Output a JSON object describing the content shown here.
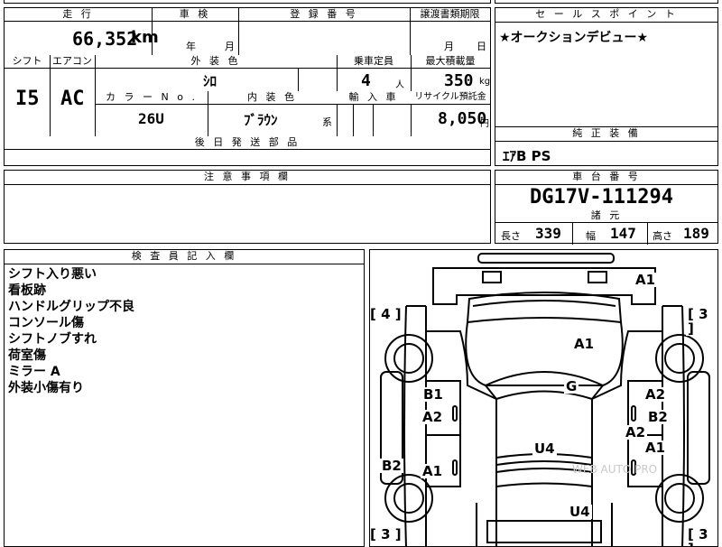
{
  "header_labels": {
    "mileage": "走 行",
    "inspection": "車 検",
    "registration_no": "登 録 番 号",
    "transfer_doc_date": "譲渡書類期限",
    "sales_point": "セ ー ル ス ポ イ ン ト",
    "shift": "シフト",
    "aircon": "エアコン",
    "exterior_color": "外 装 色",
    "capacity": "乗車定員",
    "max_load": "最大積載量",
    "color_no": "カ ラ ー N o .",
    "interior_color": "内 装 色",
    "imported": "輸 入 車",
    "recycle_fee": "リサイクル預託金",
    "later_parts": "後 日 発 送 部 品",
    "standard_equipment": "純 正 装 備",
    "caution": "注 意 事 項 欄",
    "chassis_no": "車 台 番 号",
    "specs": "諸 元",
    "inspector_notes": "検 査 員 記 入 欄"
  },
  "values": {
    "mileage": "66,352",
    "mileage_unit": "km",
    "year_unit": "年",
    "month_unit": "月",
    "doc_month_unit": "月",
    "doc_day_unit": "日",
    "sales_point": "★オークションデビュー★",
    "shift": "I5",
    "aircon": "AC",
    "exterior_color": "ｼﾛ",
    "capacity": "4",
    "capacity_unit": "人",
    "max_load": "350",
    "max_load_unit": "kg",
    "color_no": "26U",
    "interior_color": "ﾌﾞﾗｳﾝ",
    "interior_suffix": "系",
    "recycle_fee": "8,050",
    "recycle_unit": "円",
    "standard_equipment": "ｴｱB PS",
    "chassis_no": "DG17V-111294",
    "length_label": "長さ",
    "length": "339",
    "width_label": "幅",
    "width": "147",
    "height_label": "高さ",
    "height": "189"
  },
  "inspector_notes": [
    "シフト入り悪い",
    "看板跡",
    "ハンドルグリップ不良",
    "コンソール傷",
    "シフトノブすれ",
    "荷室傷",
    "ミラー A",
    "外装小傷有り"
  ],
  "diagram": {
    "tire_left_top": "[ 4 ]",
    "tire_right_top": "[ 3 ]",
    "tire_left_bottom": "[ 3 ]",
    "tire_right_bottom": "[ 3 ]",
    "watermark": "WEB AUTO PRO",
    "marks": {
      "front_roof": "A1",
      "hood": "A1",
      "windshield": "G",
      "left_front_door_1": "B1",
      "left_front_door_2": "A2",
      "right_front_door_1": "A2",
      "right_front_door_2": "B2",
      "right_rear_1": "A2",
      "right_rear_2": "A1",
      "left_rear_1": "B2",
      "left_rear_2": "A1",
      "roof": "U4",
      "rear": "U4"
    }
  }
}
